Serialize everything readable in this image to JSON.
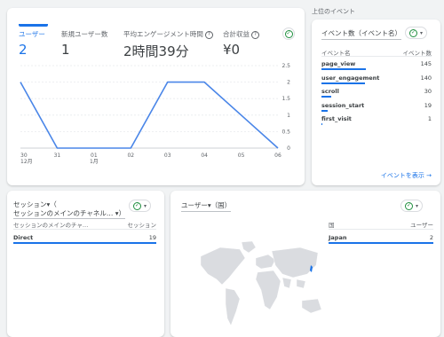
{
  "overview": {
    "metrics": [
      {
        "label": "ユーザー",
        "value": "2"
      },
      {
        "label": "新規ユーザー数",
        "value": "1"
      },
      {
        "label": "平均エンゲージメント時間",
        "value": "2時間39分"
      },
      {
        "label": "合計収益",
        "value": "¥0"
      }
    ]
  },
  "chart_data": {
    "type": "line",
    "x": [
      "30",
      "31",
      "01",
      "02",
      "03",
      "04",
      "05",
      "06"
    ],
    "x_sublabels": {
      "30": "12月",
      "01": "1月"
    },
    "series": [
      {
        "values": [
          2,
          0,
          0,
          0,
          2,
          2,
          1,
          0
        ]
      }
    ],
    "yticks": [
      "0",
      "0.5",
      "1",
      "1.5",
      "2",
      "2.5"
    ],
    "ylim": [
      0,
      2.5
    ],
    "color": "#4a86e8"
  },
  "events": {
    "header": "上位のイベント",
    "dropdown": "イベント数（イベント名）",
    "col_name": "イベント名",
    "col_count": "イベント数",
    "rows": [
      {
        "name": "page_view",
        "count": "145",
        "ratio": 1.0
      },
      {
        "name": "user_engagement",
        "count": "140",
        "ratio": 0.97
      },
      {
        "name": "scroll",
        "count": "30",
        "ratio": 0.21
      },
      {
        "name": "session_start",
        "count": "19",
        "ratio": 0.13
      },
      {
        "name": "first_visit",
        "count": "1",
        "ratio": 0.01
      }
    ],
    "link": "イベントを表示"
  },
  "sessions": {
    "title_line1": "セッション▾（",
    "title_line2": "セッションのメインのチャネル… ▾）",
    "col_name": "セッションのメインのチャ…",
    "col_count": "セッション",
    "rows": [
      {
        "name": "Direct",
        "count": "19",
        "ratio": 1.0
      }
    ]
  },
  "users_country": {
    "title": "ユーザー▾（国）",
    "col_name": "国",
    "col_count": "ユーザー",
    "rows": [
      {
        "name": "Japan",
        "count": "2",
        "ratio": 1.0
      }
    ]
  },
  "icons": {
    "check": "✓",
    "caret": "▾",
    "arrow": "→",
    "help": "?"
  }
}
